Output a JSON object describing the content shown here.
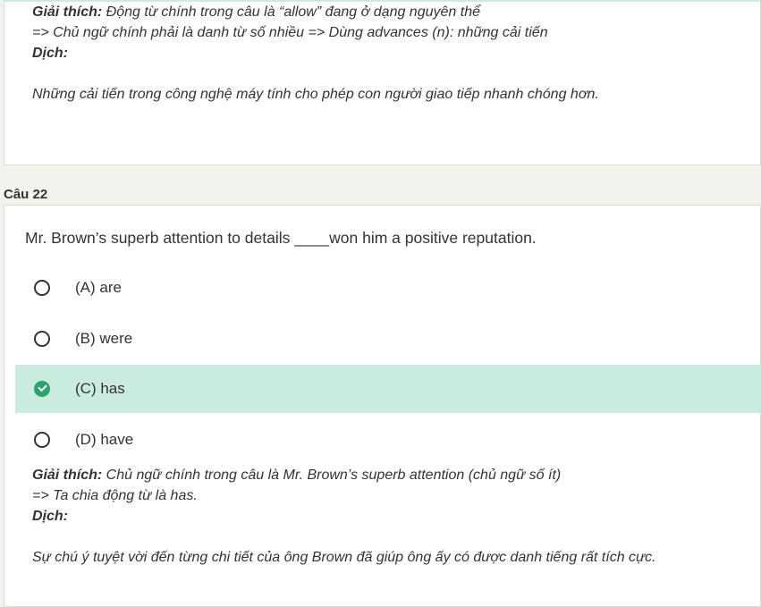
{
  "prev_card": {
    "explanation_label": "Giải thích:",
    "explanation_text": " Động từ chính trong câu là “allow” đang ở dạng nguyên thể",
    "explanation_line2": "=> Chủ ngữ chính phải là danh từ số nhiều => Dùng advances (n): những cải tiến",
    "translation_label": "Dịch:",
    "translation_text": "Những cải tiến trong công nghệ máy tính cho phép con người giao tiếp nhanh chóng hơn."
  },
  "question": {
    "number_label": "Câu 22",
    "text": "Mr. Brown’s superb attention to details ____won him a positive reputation.",
    "options": [
      {
        "label": "(A) are",
        "correct": false
      },
      {
        "label": "(B) were",
        "correct": false
      },
      {
        "label": "(C) has",
        "correct": true
      },
      {
        "label": "(D) have",
        "correct": false
      }
    ],
    "explanation_label": "Giải thích:",
    "explanation_text": " Chủ ngữ chính trong câu là Mr. Brown’s superb attention (chủ ngữ số ít)",
    "explanation_line2": "=> Ta chia động từ là has.",
    "translation_label": "Dịch:",
    "translation_text": "Sự chú ý tuyệt vời đến từng chi tiết của ông Brown đã giúp ông ấy có được danh tiếng rất tích cực."
  },
  "colors": {
    "correct_highlight": "#c9ecdf",
    "check_green": "#2aa56d"
  }
}
